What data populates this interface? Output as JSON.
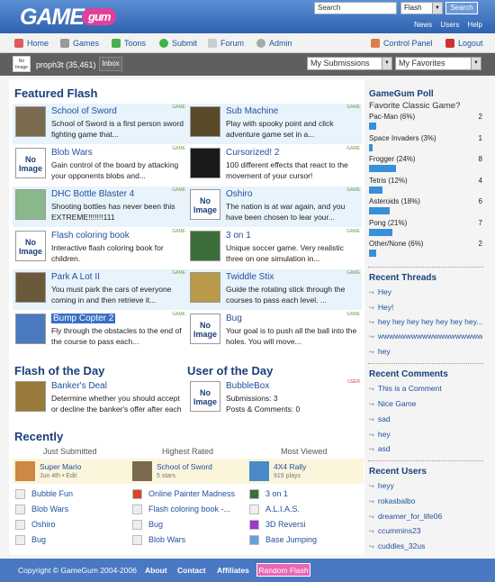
{
  "header": {
    "logo_game": "GAME",
    "logo_gum": "gum",
    "search_placeholder": "Search",
    "search_select": "Flash",
    "search_button": "Search",
    "links": [
      "News",
      "Users",
      "Help"
    ]
  },
  "nav": {
    "home": "Home",
    "games": "Games",
    "toons": "Toons",
    "submit": "Submit",
    "forum": "Forum",
    "admin": "Admin",
    "control_panel": "Control Panel",
    "logout": "Logout"
  },
  "userbar": {
    "avatar_text": "No Image",
    "username": "proph3t (35,461)",
    "inbox": "Inbox",
    "submissions": "My Submissions",
    "favorites": "My Favorites"
  },
  "featured": {
    "title": "Featured Flash",
    "tag": "GAME",
    "items": [
      {
        "title": "School of Sword",
        "desc": "School of Sword is a first person sword fighting game that..."
      },
      {
        "title": "Sub Machine",
        "desc": "Play with spooky point and click adventure game set in a..."
      },
      {
        "title": "Blob Wars",
        "desc": "Gain control of the board by attacking your opponents blobs and..."
      },
      {
        "title": "Cursorized! 2",
        "desc": "100 different effects that react to the movement of your cursor!"
      },
      {
        "title": "DHC Bottle Blaster 4",
        "desc": "Shooting bottles has never been this EXTREME!!!!!!!111"
      },
      {
        "title": "Oshiro",
        "desc": "The nation is at war again, and you have been chosen to lear your..."
      },
      {
        "title": "Flash coloring book",
        "desc": "Interactive flash coloring book for children."
      },
      {
        "title": "3 on 1",
        "desc": "Unique soccer game. Very realistic three on one simulation in..."
      },
      {
        "title": "Park A Lot II",
        "desc": "You must park the cars of everyone coming in and then retrieve it..."
      },
      {
        "title": "Twiddle Stix",
        "desc": "Guide the rotating stick through the courses to pass each level. ..."
      },
      {
        "title": "Bump Copter 2",
        "desc": "Fly through the obstacles to the end of the course to pass each..."
      },
      {
        "title": "Bug",
        "desc": "Your goal is to push all the ball into the holes. You will move..."
      }
    ]
  },
  "no_image": "No Image",
  "fotd": {
    "title": "Flash of the Day",
    "name": "Banker's Deal",
    "desc": "Determine whether you should accept or decline the banker's offer after each"
  },
  "uotd": {
    "title": "User of the Day",
    "tag": "USER",
    "name": "BubbleBox",
    "subs": "Submissions: 3",
    "posts": "Posts & Comments: 0"
  },
  "recent": {
    "title": "Recently",
    "col1": "Just Submitted",
    "col2": "Highest Rated",
    "col3": "Most Viewed",
    "top1": {
      "name": "Super Mario",
      "meta": "Jun 4th • Edit"
    },
    "top2": {
      "name": "School of Sword",
      "meta": "5 stars"
    },
    "top3": {
      "name": "4X4 Rally",
      "meta": "919 plays"
    },
    "c1": [
      "Bubble Fun",
      "Blob Wars",
      "Oshiro",
      "Bug"
    ],
    "c2": [
      "Online Painter Madness",
      "Flash coloring book -...",
      "Bug",
      "Blob Wars"
    ],
    "c3": [
      "3 on 1",
      "A.L.I.A.S.",
      "3D Reversi",
      "Base Jumping"
    ]
  },
  "poll": {
    "title": "GameGum Poll",
    "question": "Favorite Classic Game?",
    "options": [
      {
        "label": "Pac-Man (6%)",
        "count": "2",
        "pct": 0.06
      },
      {
        "label": "Space Invaders (3%)",
        "count": "1",
        "pct": 0.03
      },
      {
        "label": "Frogger (24%)",
        "count": "8",
        "pct": 0.24
      },
      {
        "label": "Tetris (12%)",
        "count": "4",
        "pct": 0.12
      },
      {
        "label": "Asteroids (18%)",
        "count": "6",
        "pct": 0.18
      },
      {
        "label": "Pong (21%)",
        "count": "7",
        "pct": 0.21
      },
      {
        "label": "Other/None (6%)",
        "count": "2",
        "pct": 0.06
      }
    ]
  },
  "threads": {
    "title": "Recent Threads",
    "items": [
      "Hey",
      "Hey!",
      "hey hey hey hey hey hey hey...",
      "wwwwwwwwwwwwwwwwwwwwwwww...",
      "hey"
    ]
  },
  "comments": {
    "title": "Recent Comments",
    "items": [
      "This is a Comment",
      "Nice Game",
      "sad",
      "hey",
      "asd"
    ]
  },
  "users": {
    "title": "Recent Users",
    "items": [
      "heyy",
      "rokasbalbo",
      "dreamer_for_life06",
      "ccummins23",
      "cuddles_32us"
    ]
  },
  "footer": {
    "copyright": "Copyright © GameGum 2004-2006",
    "about": "About",
    "contact": "Contact",
    "affiliates": "Affiliates",
    "random": "Random Flash"
  }
}
